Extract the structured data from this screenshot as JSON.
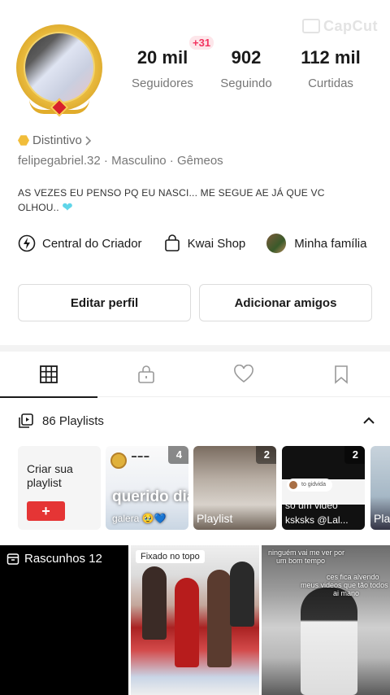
{
  "watermark": "CapCut",
  "profile": {
    "plus_badge": "+31",
    "stats": {
      "followers": {
        "value": "20 mil",
        "label": "Seguidores"
      },
      "following": {
        "value": "902",
        "label": "Seguindo"
      },
      "likes": {
        "value": "112 mil",
        "label": "Curtidas"
      }
    },
    "badge_label": "Distintivo",
    "username": "felipegabriel.32",
    "gender": "Masculino",
    "sign": "Gêmeos",
    "bio_line1": "AS VEZES EU PENSO PQ EU NASCI...  ME SEGUE AE JÁ QUE VC",
    "bio_line2": "OLHOU.."
  },
  "links": {
    "creator": "Central do Criador",
    "shop": "Kwai Shop",
    "family": "Minha família"
  },
  "buttons": {
    "edit": "Editar perfil",
    "add": "Adicionar amigos"
  },
  "playlists": {
    "header": "86 Playlists",
    "create_label": "Criar sua playlist",
    "create_plus": "+",
    "cards": [
      {
        "count": "4",
        "big_text": "querido diário...",
        "small_text": "galera"
      },
      {
        "count": "2",
        "caption": "Playlist"
      },
      {
        "count": "2",
        "chip": "to gidvida",
        "line1": "so um video",
        "line2": "ksksks @Lal..."
      },
      {
        "caption": "Pla"
      }
    ]
  },
  "grid": {
    "drafts_label": "Rascunhos 12",
    "pinned_label": "Fixado no topo",
    "third_lines": [
      "ninguém vai me ver por",
      "um bom tempo",
      "ces fica alvendo",
      "meus videos que tão todos",
      "ai mano"
    ]
  }
}
